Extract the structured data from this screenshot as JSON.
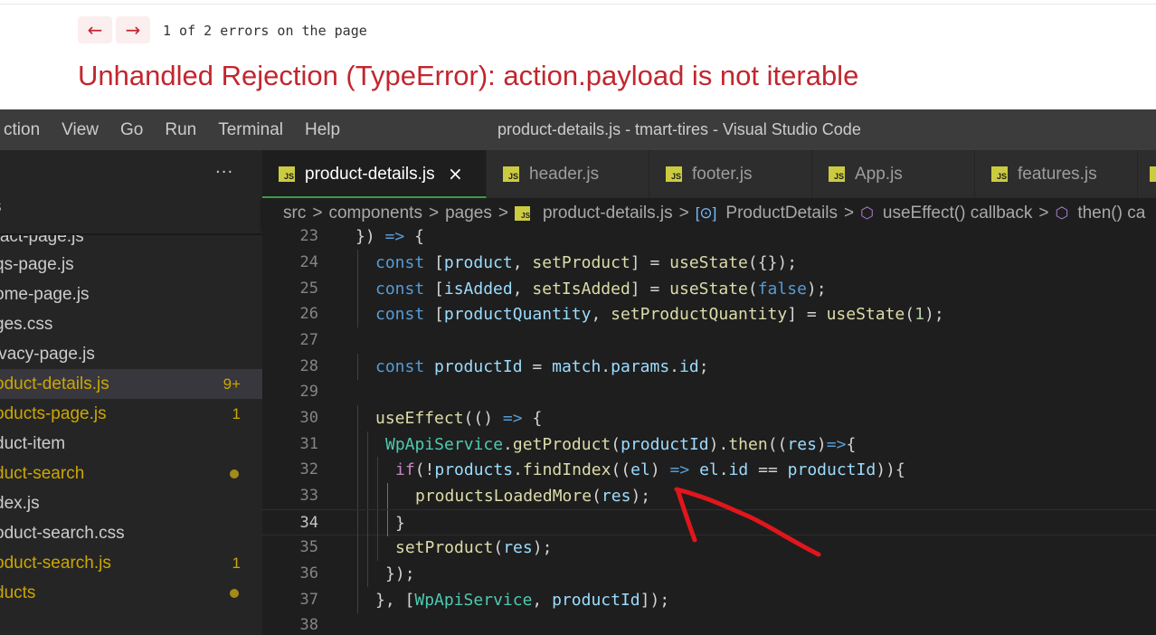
{
  "error_overlay": {
    "prev_label": "←",
    "next_label": "→",
    "count_text": "1 of 2 errors on the page",
    "title": "Unhandled Rejection (TypeError): action.payload is not iterable"
  },
  "window": {
    "title": "product-details.js - tmart-tires - Visual Studio Code",
    "menu": [
      "ction",
      "View",
      "Go",
      "Run",
      "Terminal",
      "Help"
    ]
  },
  "sidebar": {
    "more_label": "···",
    "header": "s",
    "files": [
      {
        "name": "ntact-page.js",
        "modified": false,
        "badge": ""
      },
      {
        "name": "qs-page.js",
        "modified": false,
        "badge": ""
      },
      {
        "name": "ome-page.js",
        "modified": false,
        "badge": ""
      },
      {
        "name": "ges.css",
        "modified": false,
        "badge": ""
      },
      {
        "name": "ivacy-page.js",
        "modified": false,
        "badge": ""
      },
      {
        "name": "oduct-details.js",
        "modified": true,
        "badge": "9+",
        "active": true
      },
      {
        "name": "oducts-page.js",
        "modified": true,
        "badge": "1"
      },
      {
        "name": "duct-item",
        "modified": false,
        "badge": ""
      },
      {
        "name": "duct-search",
        "modified": true,
        "badge": "",
        "dot": true
      },
      {
        "name": "dex.js",
        "modified": false,
        "badge": ""
      },
      {
        "name": "oduct-search.css",
        "modified": false,
        "badge": ""
      },
      {
        "name": "oduct-search.js",
        "modified": true,
        "badge": "1"
      },
      {
        "name": "ducts",
        "modified": true,
        "badge": "",
        "dot": true
      }
    ]
  },
  "tabs": [
    {
      "label": "product-details.js",
      "icon": "JS",
      "active": true,
      "close": "×"
    },
    {
      "label": "header.js",
      "icon": "JS",
      "active": false
    },
    {
      "label": "footer.js",
      "icon": "JS",
      "active": false
    },
    {
      "label": "App.js",
      "icon": "JS",
      "active": false
    },
    {
      "label": "features.js",
      "icon": "JS",
      "active": false
    }
  ],
  "breadcrumb": {
    "items": [
      "src",
      "components",
      "pages",
      "product-details.js",
      "ProductDetails",
      "useEffect() callback",
      "then() ca"
    ],
    "separator": ">",
    "js_icon": "JS",
    "class_sym": "[⊙]",
    "method_sym": "⬡"
  },
  "editor": {
    "current_line": 34,
    "lines": [
      {
        "n": 23,
        "text": "}) => {"
      },
      {
        "n": 24,
        "text": "const [product, setProduct] = useState({});"
      },
      {
        "n": 25,
        "text": "const [isAdded, setIsAdded] = useState(false);"
      },
      {
        "n": 26,
        "text": "const [productQuantity, setProductQuantity] = useState(1);"
      },
      {
        "n": 27,
        "text": ""
      },
      {
        "n": 28,
        "text": "const productId = match.params.id;"
      },
      {
        "n": 29,
        "text": ""
      },
      {
        "n": 30,
        "text": "useEffect(() => {"
      },
      {
        "n": 31,
        "text": "WpApiService.getProduct(productId).then((res)=>{"
      },
      {
        "n": 32,
        "text": "if(!products.findIndex((el) => el.id == productId)){"
      },
      {
        "n": 33,
        "text": "productsLoadedMore(res);"
      },
      {
        "n": 34,
        "text": "}"
      },
      {
        "n": 35,
        "text": "setProduct(res);"
      },
      {
        "n": 36,
        "text": "});"
      },
      {
        "n": 37,
        "text": "}, [WpApiService, productId]);"
      },
      {
        "n": 38,
        "text": ""
      }
    ]
  },
  "colors": {
    "error_red": "#c2262e",
    "keyword_blue": "#569cd6",
    "variable": "#9cdcfe",
    "function": "#dcdcaa",
    "class": "#4ec9b0",
    "number": "#b5cea8",
    "control": "#c586c0",
    "git_modified": "#cca700",
    "annotation_red": "#e0161c"
  }
}
